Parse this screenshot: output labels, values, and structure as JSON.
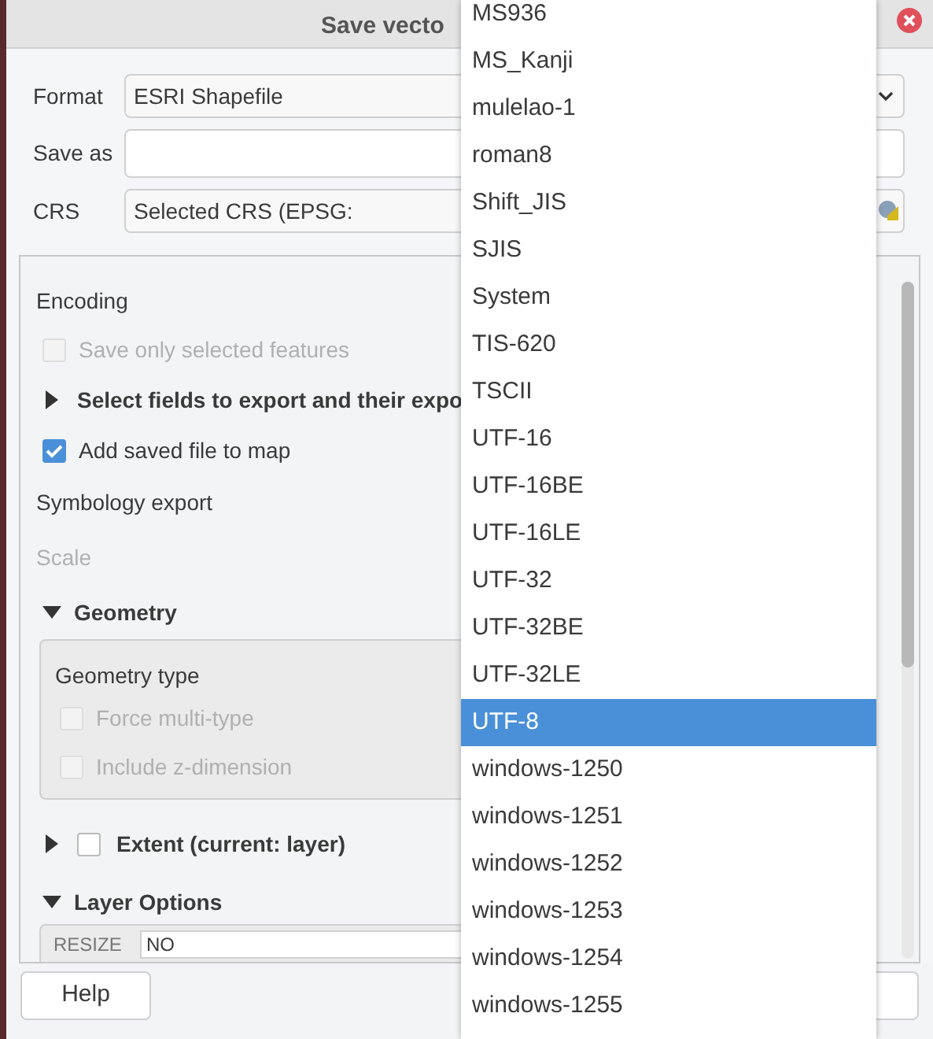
{
  "window": {
    "title": "Save vecto"
  },
  "form": {
    "format": {
      "label": "Format",
      "value": "ESRI Shapefile"
    },
    "save_as": {
      "label": "Save as"
    },
    "crs": {
      "label": "CRS",
      "value": "Selected CRS (EPSG:"
    }
  },
  "options": {
    "encoding": {
      "label": "Encoding"
    },
    "save_selected": {
      "label": "Save only selected features",
      "checked": false,
      "disabled": true
    },
    "select_fields": {
      "label": "Select fields to export and their expo",
      "expanded": false
    },
    "add_to_map": {
      "label": "Add saved file to map",
      "checked": true
    },
    "symbology": {
      "label": "Symbology export"
    },
    "scale": {
      "label": "Scale",
      "disabled": true
    },
    "geometry": {
      "label": "Geometry",
      "expanded": true,
      "group_title": "Geometry type",
      "options": [
        {
          "label": "Force multi-type",
          "checked": false,
          "disabled": true
        },
        {
          "label": "Include z-dimension",
          "checked": false,
          "disabled": true
        }
      ]
    },
    "extent": {
      "label": "Extent (current: layer)",
      "expanded": false,
      "checked": false
    },
    "layer_options": {
      "label": "Layer Options",
      "expanded": true,
      "rows": [
        {
          "key": "RESIZE",
          "value": "NO"
        }
      ]
    }
  },
  "buttons": {
    "help": "Help"
  },
  "dropdown": {
    "items": [
      {
        "label": "MS936",
        "selected": false
      },
      {
        "label": "MS_Kanji",
        "selected": false
      },
      {
        "label": "mulelao-1",
        "selected": false
      },
      {
        "label": "roman8",
        "selected": false
      },
      {
        "label": "Shift_JIS",
        "selected": false
      },
      {
        "label": "SJIS",
        "selected": false
      },
      {
        "label": "System",
        "selected": false
      },
      {
        "label": "TIS-620",
        "selected": false
      },
      {
        "label": "TSCII",
        "selected": false
      },
      {
        "label": "UTF-16",
        "selected": false
      },
      {
        "label": "UTF-16BE",
        "selected": false
      },
      {
        "label": "UTF-16LE",
        "selected": false
      },
      {
        "label": "UTF-32",
        "selected": false
      },
      {
        "label": "UTF-32BE",
        "selected": false
      },
      {
        "label": "UTF-32LE",
        "selected": false
      },
      {
        "label": "UTF-8",
        "selected": true
      },
      {
        "label": "windows-1250",
        "selected": false
      },
      {
        "label": "windows-1251",
        "selected": false
      },
      {
        "label": "windows-1252",
        "selected": false
      },
      {
        "label": "windows-1253",
        "selected": false
      },
      {
        "label": "windows-1254",
        "selected": false
      },
      {
        "label": "windows-1255",
        "selected": false
      }
    ]
  }
}
